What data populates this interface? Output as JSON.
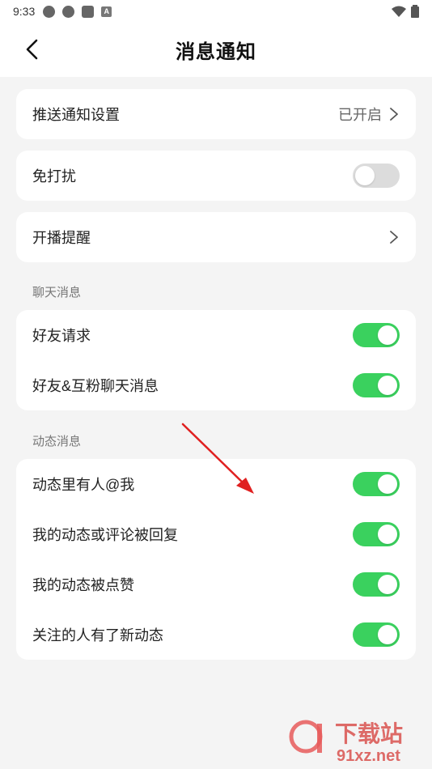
{
  "status_bar": {
    "time": "9:33"
  },
  "header": {
    "title": "消息通知"
  },
  "push": {
    "label": "推送通知设置",
    "value": "已开启"
  },
  "dnd": {
    "label": "免打扰",
    "state": "off"
  },
  "live": {
    "label": "开播提醒"
  },
  "chat_section": {
    "title": "聊天消息",
    "items": [
      {
        "label": "好友请求",
        "state": "on"
      },
      {
        "label": "好友&互粉聊天消息",
        "state": "on"
      }
    ]
  },
  "feed_section": {
    "title": "动态消息",
    "items": [
      {
        "label": "动态里有人@我",
        "state": "on"
      },
      {
        "label": "我的动态或评论被回复",
        "state": "on"
      },
      {
        "label": "我的动态被点赞",
        "state": "on"
      },
      {
        "label": "关注的人有了新动态",
        "state": "on"
      }
    ]
  },
  "watermark": {
    "brand": "下载站",
    "domain": "91xz.net"
  },
  "colors": {
    "toggle_on": "#3ad15e",
    "toggle_off": "#dcdcdc",
    "annotation_arrow": "#e02020"
  }
}
